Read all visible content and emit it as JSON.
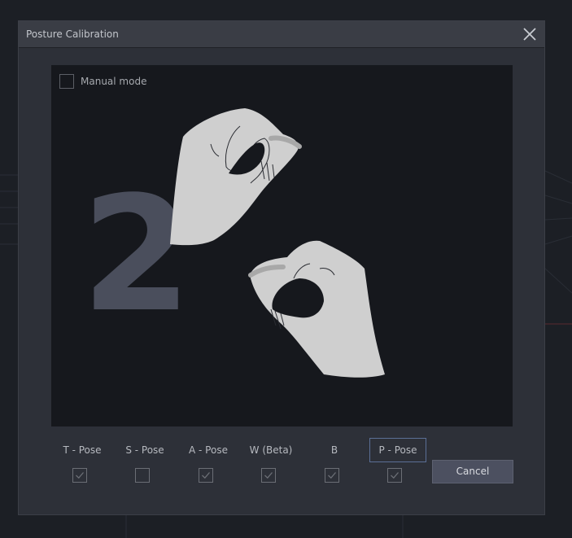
{
  "dialog": {
    "title": "Posture Calibration",
    "close_icon": "close-icon"
  },
  "preview": {
    "manual_mode_label": "Manual mode",
    "manual_mode_checked": false,
    "step_number": "2"
  },
  "poses": [
    {
      "label": "T - Pose",
      "checked": true,
      "selected": false
    },
    {
      "label": "S - Pose",
      "checked": false,
      "selected": false
    },
    {
      "label": "A - Pose",
      "checked": true,
      "selected": false
    },
    {
      "label": "W (Beta)",
      "checked": true,
      "selected": false
    },
    {
      "label": "B",
      "checked": true,
      "selected": false
    },
    {
      "label": "P - Pose",
      "checked": true,
      "selected": true
    }
  ],
  "buttons": {
    "cancel_label": "Cancel"
  },
  "colors": {
    "dialog_bg": "#2d3038",
    "preview_bg": "#16181d",
    "step_number": "#4a4e5c",
    "hand_fill": "#cfcfcf",
    "selected_border": "#5b6f96"
  }
}
